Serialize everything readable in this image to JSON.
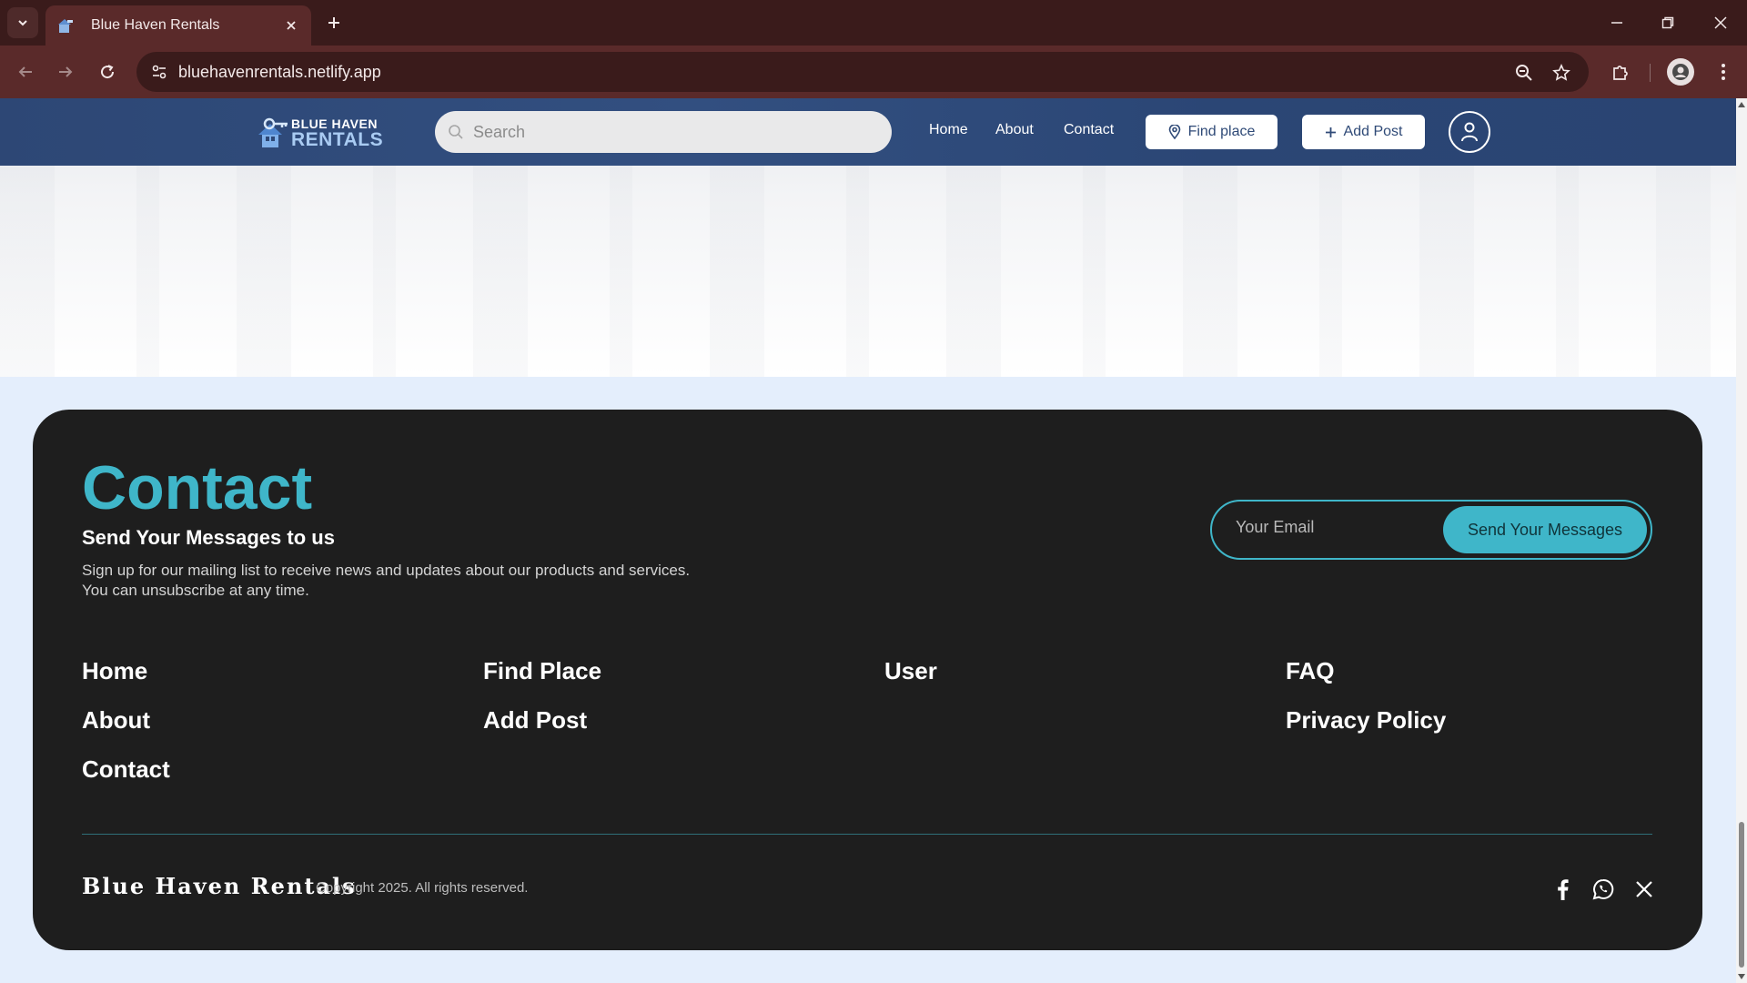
{
  "browser": {
    "tab_title": "Blue Haven Rentals",
    "url": "bluehavenrentals.netlify.app"
  },
  "site": {
    "logo_line1": "BLUE HAVEN",
    "logo_line2": "RENTALS",
    "search_placeholder": "Search",
    "nav": [
      "Home",
      "About",
      "Contact"
    ],
    "find_place_label": "Find place",
    "add_post_label": "Add Post"
  },
  "footer": {
    "title": "Contact",
    "subtitle": "Send Your Messages to us",
    "description_line1": "Sign up for our mailing list to receive news and updates about our products and services.",
    "description_line2": "You can unsubscribe at any time.",
    "email_placeholder": "Your Email",
    "send_label": "Send Your Messages",
    "columns": [
      [
        "Home",
        "About",
        "Contact"
      ],
      [
        "Find Place",
        "Add Post"
      ],
      [
        "User"
      ],
      [
        "FAQ",
        "Privacy Policy"
      ]
    ],
    "brand": "Blue Haven Rentals",
    "copyright": "Copyright 2025. All rights reserved.",
    "social_icons": [
      "facebook-icon",
      "whatsapp-icon",
      "x-icon"
    ]
  },
  "colors": {
    "accent": "#3fb6c9",
    "header": "#2d4775",
    "footer_card": "#1e1e1e",
    "browser_frame": "#5a2a2a"
  }
}
